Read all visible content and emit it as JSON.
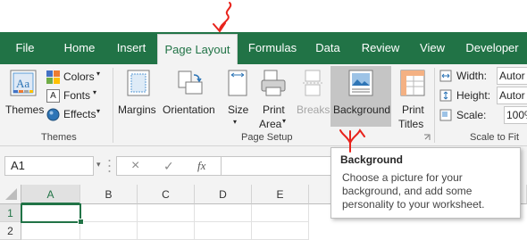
{
  "tabs": [
    {
      "label": "File",
      "active": false
    },
    {
      "label": "Home",
      "active": false
    },
    {
      "label": "Insert",
      "active": false
    },
    {
      "label": "Page Layout",
      "active": true
    },
    {
      "label": "Formulas",
      "active": false
    },
    {
      "label": "Data",
      "active": false
    },
    {
      "label": "Review",
      "active": false
    },
    {
      "label": "View",
      "active": false
    },
    {
      "label": "Developer",
      "active": false
    }
  ],
  "ribbon": {
    "themes_group": {
      "themes_label": "Themes",
      "colors_label": "Colors",
      "fonts_label": "Fonts",
      "effects_label": "Effects",
      "group_label": "Themes"
    },
    "page_setup_group": {
      "margins_label": "Margins",
      "orientation_label": "Orientation",
      "size_label": "Size",
      "print_area_line1": "Print",
      "print_area_line2": "Area",
      "breaks_label": "Breaks",
      "background_label": "Background",
      "print_titles_line1": "Print",
      "print_titles_line2": "Titles",
      "group_label": "Page Setup"
    },
    "scale_group": {
      "width_label": "Width:",
      "width_value": "Autor",
      "height_label": "Height:",
      "height_value": "Autor",
      "scale_label": "Scale:",
      "scale_value": "100%",
      "group_label": "Scale to Fit"
    }
  },
  "formula_bar": {
    "name_box": "A1",
    "cancel_icon": "×",
    "enter_icon": "✓",
    "fx_label": "fx"
  },
  "grid": {
    "columns": [
      "A",
      "B",
      "C",
      "D",
      "E"
    ],
    "rows": [
      "1",
      "2"
    ]
  },
  "tooltip": {
    "title": "Background",
    "body": "Choose a picture for your background, and add some personality to your worksheet."
  },
  "colors": {
    "tab_bar": "#217346",
    "ribbon": "#f3f3f3",
    "annotation": "#e8231c",
    "selection": "#217346"
  }
}
